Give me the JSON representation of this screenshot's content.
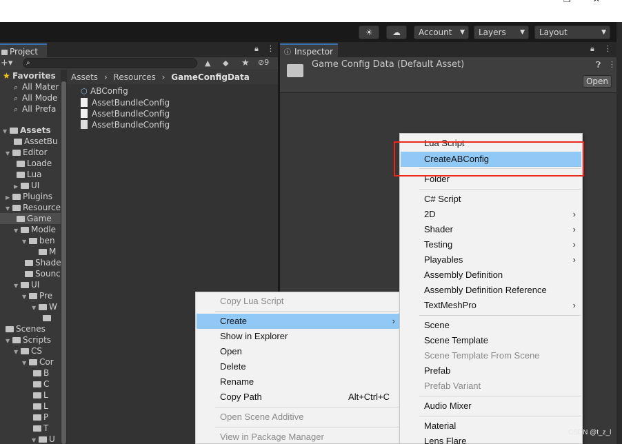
{
  "toolbar": {
    "account_label": "Account",
    "layers_label": "Layers",
    "layout_label": "Layout"
  },
  "project": {
    "tab_label": "Project",
    "search_placeholder": "",
    "hidden_count": "9",
    "breadcrumb": [
      "Assets",
      "Resources",
      "GameConfigData"
    ],
    "tree": [
      {
        "label": "Favorites",
        "kind": "star"
      },
      {
        "label": "All Mater",
        "kind": "search"
      },
      {
        "label": "All Mode",
        "kind": "search"
      },
      {
        "label": "All Prefa",
        "kind": "search"
      },
      {
        "label": "Assets",
        "kind": "folder"
      },
      {
        "label": "AssetBu",
        "kind": "folder"
      },
      {
        "label": "Editor",
        "kind": "folder"
      },
      {
        "label": "Loade",
        "kind": "folder"
      },
      {
        "label": "Lua",
        "kind": "folder"
      },
      {
        "label": "UI",
        "kind": "folder"
      },
      {
        "label": "Plugins",
        "kind": "folder"
      },
      {
        "label": "Resource",
        "kind": "folder"
      },
      {
        "label": "Game",
        "kind": "folder"
      },
      {
        "label": "Modle",
        "kind": "folder"
      },
      {
        "label": "ben",
        "kind": "folder"
      },
      {
        "label": "M",
        "kind": "folder"
      },
      {
        "label": "Shade",
        "kind": "folder"
      },
      {
        "label": "Sounc",
        "kind": "folder"
      },
      {
        "label": "UI",
        "kind": "folder"
      },
      {
        "label": "Pre",
        "kind": "folder"
      },
      {
        "label": "W",
        "kind": "folder"
      },
      {
        "label": "",
        "kind": "folder"
      },
      {
        "label": "Scenes",
        "kind": "folder"
      },
      {
        "label": "Scripts",
        "kind": "folder"
      },
      {
        "label": "CS",
        "kind": "folder"
      },
      {
        "label": "Cor",
        "kind": "folder"
      },
      {
        "label": "B",
        "kind": "folder"
      },
      {
        "label": "C",
        "kind": "folder"
      },
      {
        "label": "L",
        "kind": "folder"
      },
      {
        "label": "L",
        "kind": "folder"
      },
      {
        "label": "P",
        "kind": "folder"
      },
      {
        "label": "T",
        "kind": "folder"
      },
      {
        "label": "U",
        "kind": "folder"
      }
    ],
    "assets": [
      "ABConfig",
      "AssetBundleConfig",
      "AssetBundleConfig",
      "AssetBundleConfig"
    ]
  },
  "inspector": {
    "tab_label": "Inspector",
    "title": "Game Config Data (Default Asset)",
    "open_label": "Open"
  },
  "context_menu": {
    "items": [
      "Copy Lua Script",
      "Create",
      "Show in Explorer",
      "Open",
      "Delete",
      "Rename",
      "Copy Path",
      "Open Scene Additive",
      "View in Package Manager"
    ],
    "copy_path_shortcut": "Alt+Ctrl+C"
  },
  "create_submenu": {
    "items": [
      "Lua Script",
      "CreateABConfig",
      "Folder",
      "C# Script",
      "2D",
      "Shader",
      "Testing",
      "Playables",
      "Assembly Definition",
      "Assembly Definition Reference",
      "TextMeshPro",
      "Scene",
      "Scene Template",
      "Scene Template From Scene",
      "Prefab",
      "Prefab Variant",
      "Audio Mixer",
      "Material",
      "Lens Flare"
    ]
  },
  "watermark": "CSDN @t_z_l",
  "colors": {
    "highlight": "#90c8f6",
    "annotation_red": "#e8281e",
    "tab_accent": "#3a72b0"
  }
}
